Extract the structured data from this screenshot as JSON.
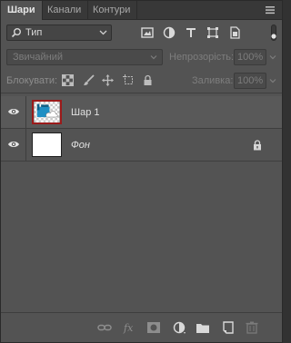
{
  "tabs": [
    {
      "label": "Шари",
      "active": true
    },
    {
      "label": "Канали",
      "active": false
    },
    {
      "label": "Контури",
      "active": false
    }
  ],
  "filter": {
    "kind_label": "Тип",
    "icons": [
      "image-filter-icon",
      "adjustment-filter-icon",
      "type-filter-icon",
      "shape-filter-icon",
      "smart-object-filter-icon"
    ]
  },
  "blend": {
    "mode": "Звичайний",
    "opacity_label": "Непрозорість:",
    "opacity_value": "100%"
  },
  "lock": {
    "label": "Блокувати:",
    "fill_label": "Заливка:",
    "fill_value": "100%"
  },
  "layers": [
    {
      "name": "Шар 1",
      "selected": true,
      "italic": false,
      "locked": false
    },
    {
      "name": "Фон",
      "selected": false,
      "italic": true,
      "locked": true
    }
  ],
  "colors": {
    "panel_bg": "#535353",
    "selection_border": "#9b1a1a",
    "accent_blue": "#1f8fc4"
  }
}
